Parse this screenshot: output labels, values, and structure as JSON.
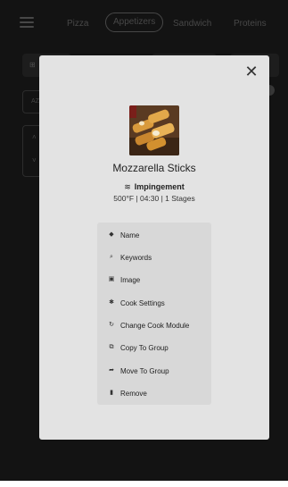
{
  "tabs": [
    {
      "label": "Pizza"
    },
    {
      "label": "Appetizers"
    },
    {
      "label": "Sandwich"
    },
    {
      "label": "Proteins"
    }
  ],
  "background": {
    "az_label": "AZ"
  },
  "modal": {
    "item_name": "Mozzarella Sticks",
    "cook_method": "Impingement",
    "specs": "500°F | 04:30 | 1 Stages",
    "close_glyph": "✕"
  },
  "actions": [
    {
      "label": "Name",
      "icon": "tag-icon",
      "glyph": "◆"
    },
    {
      "label": "Keywords",
      "icon": "search-icon",
      "glyph": "⌕"
    },
    {
      "label": "Image",
      "icon": "image-icon",
      "glyph": "▣"
    },
    {
      "label": "Cook Settings",
      "icon": "gear-icon",
      "glyph": "✱"
    },
    {
      "label": "Change Cook Module",
      "icon": "refresh-icon",
      "glyph": "↻"
    },
    {
      "label": "Copy To Group",
      "icon": "copy-icon",
      "glyph": "⧉"
    },
    {
      "label": "Move To Group",
      "icon": "move-icon",
      "glyph": "➦"
    },
    {
      "label": "Remove",
      "icon": "trash-icon",
      "glyph": "▮"
    }
  ],
  "colors": {
    "background": "#1e1e1e",
    "modal": "#e3e3e3",
    "actions_panel": "#d8d8d8"
  }
}
